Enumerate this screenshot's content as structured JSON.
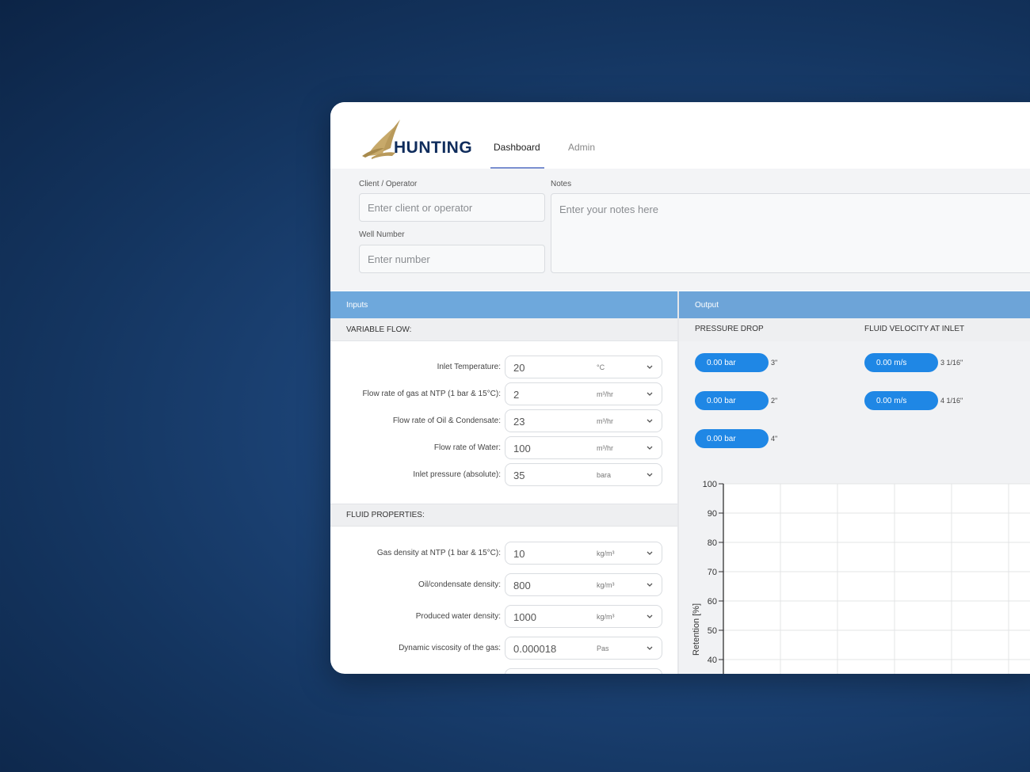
{
  "header": {
    "brand": "HUNTING",
    "tabs": [
      {
        "label": "Dashboard",
        "active": true
      },
      {
        "label": "Admin",
        "active": false
      }
    ],
    "accent": "#7a8fd0"
  },
  "client": {
    "client_label": "Client / Operator",
    "client_placeholder": "Enter client or operator",
    "well_label": "Well Number",
    "well_placeholder": "Enter number",
    "notes_label": "Notes",
    "notes_placeholder": "Enter your notes here"
  },
  "inputs": {
    "title": "Inputs",
    "variable_flow": {
      "title": "VARIABLE FLOW:",
      "rows": [
        {
          "label": "Inlet Temperature:",
          "value": "20",
          "unit": "°C"
        },
        {
          "label": "Flow rate of gas at NTP (1 bar & 15°C):",
          "value": "2",
          "unit": "m³/hr"
        },
        {
          "label": "Flow rate of Oil & Condensate:",
          "value": "23",
          "unit": "m³/hr"
        },
        {
          "label": "Flow rate of Water:",
          "value": "100",
          "unit": "m³/hr"
        },
        {
          "label": "Inlet pressure (absolute):",
          "value": "35",
          "unit": "bara"
        }
      ]
    },
    "fluid_properties": {
      "title": "FLUID PROPERTIES:",
      "rows": [
        {
          "label": "Gas density at NTP (1 bar & 15°C):",
          "value": "10",
          "unit": "kg/m³"
        },
        {
          "label": "Oil/condensate density:",
          "value": "800",
          "unit": "kg/m³"
        },
        {
          "label": "Produced water density:",
          "value": "1000",
          "unit": "kg/m³"
        },
        {
          "label": "Dynamic viscosity of the gas:",
          "value": "0.000018",
          "unit": "Pas"
        }
      ]
    }
  },
  "output": {
    "title": "Output",
    "pressure_drop": {
      "title": "PRESSURE DROP",
      "items": [
        {
          "value": "0.00 bar",
          "size": "3\""
        },
        {
          "value": "0.00 bar",
          "size": "2\""
        },
        {
          "value": "0.00 bar",
          "size": "4\""
        }
      ]
    },
    "fluid_velocity": {
      "title": "FLUID VELOCITY AT INLET",
      "items": [
        {
          "value": "0.00 m/s",
          "size": "3 1/16\""
        },
        {
          "value": "0.00 m/s",
          "size": "4 1/16\""
        }
      ]
    },
    "pill_color": "#1f87e5"
  },
  "chart_data": {
    "type": "line",
    "title": "",
    "xlabel": "",
    "ylabel": "Retention [%]",
    "ylim": [
      40,
      100
    ],
    "yticks": [
      100,
      90,
      80,
      70,
      60,
      50,
      40
    ],
    "grid": true,
    "series": []
  }
}
